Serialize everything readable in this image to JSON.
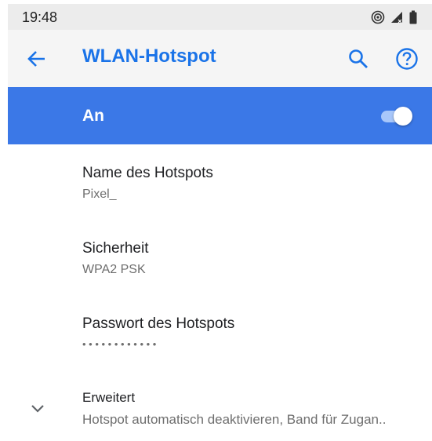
{
  "status_bar": {
    "time": "19:48",
    "icons": [
      "hotspot-icon",
      "signal-icon",
      "battery-icon"
    ]
  },
  "app_bar": {
    "title": "WLAN-Hotspot",
    "back_icon": "arrow-back-icon",
    "search_icon": "search-icon",
    "help_icon": "help-icon"
  },
  "master_switch": {
    "label": "An",
    "checked": true
  },
  "settings": [
    {
      "title": "Name des Hotspots",
      "summary": "Pixel_"
    },
    {
      "title": "Sicherheit",
      "summary": "WPA2 PSK"
    },
    {
      "title": "Passwort des Hotspots",
      "summary": "• • • • • • • • • • • •"
    },
    {
      "title": "Erweitert",
      "summary": "Hotspot automatisch deaktivieren, Band für Zugan..",
      "icon": "chevron-down-icon"
    }
  ],
  "colors": {
    "accent": "#1a73e8",
    "master_bar": "#3b78e7",
    "status_bar": "#ececec",
    "app_bar": "#f5f5f5"
  }
}
